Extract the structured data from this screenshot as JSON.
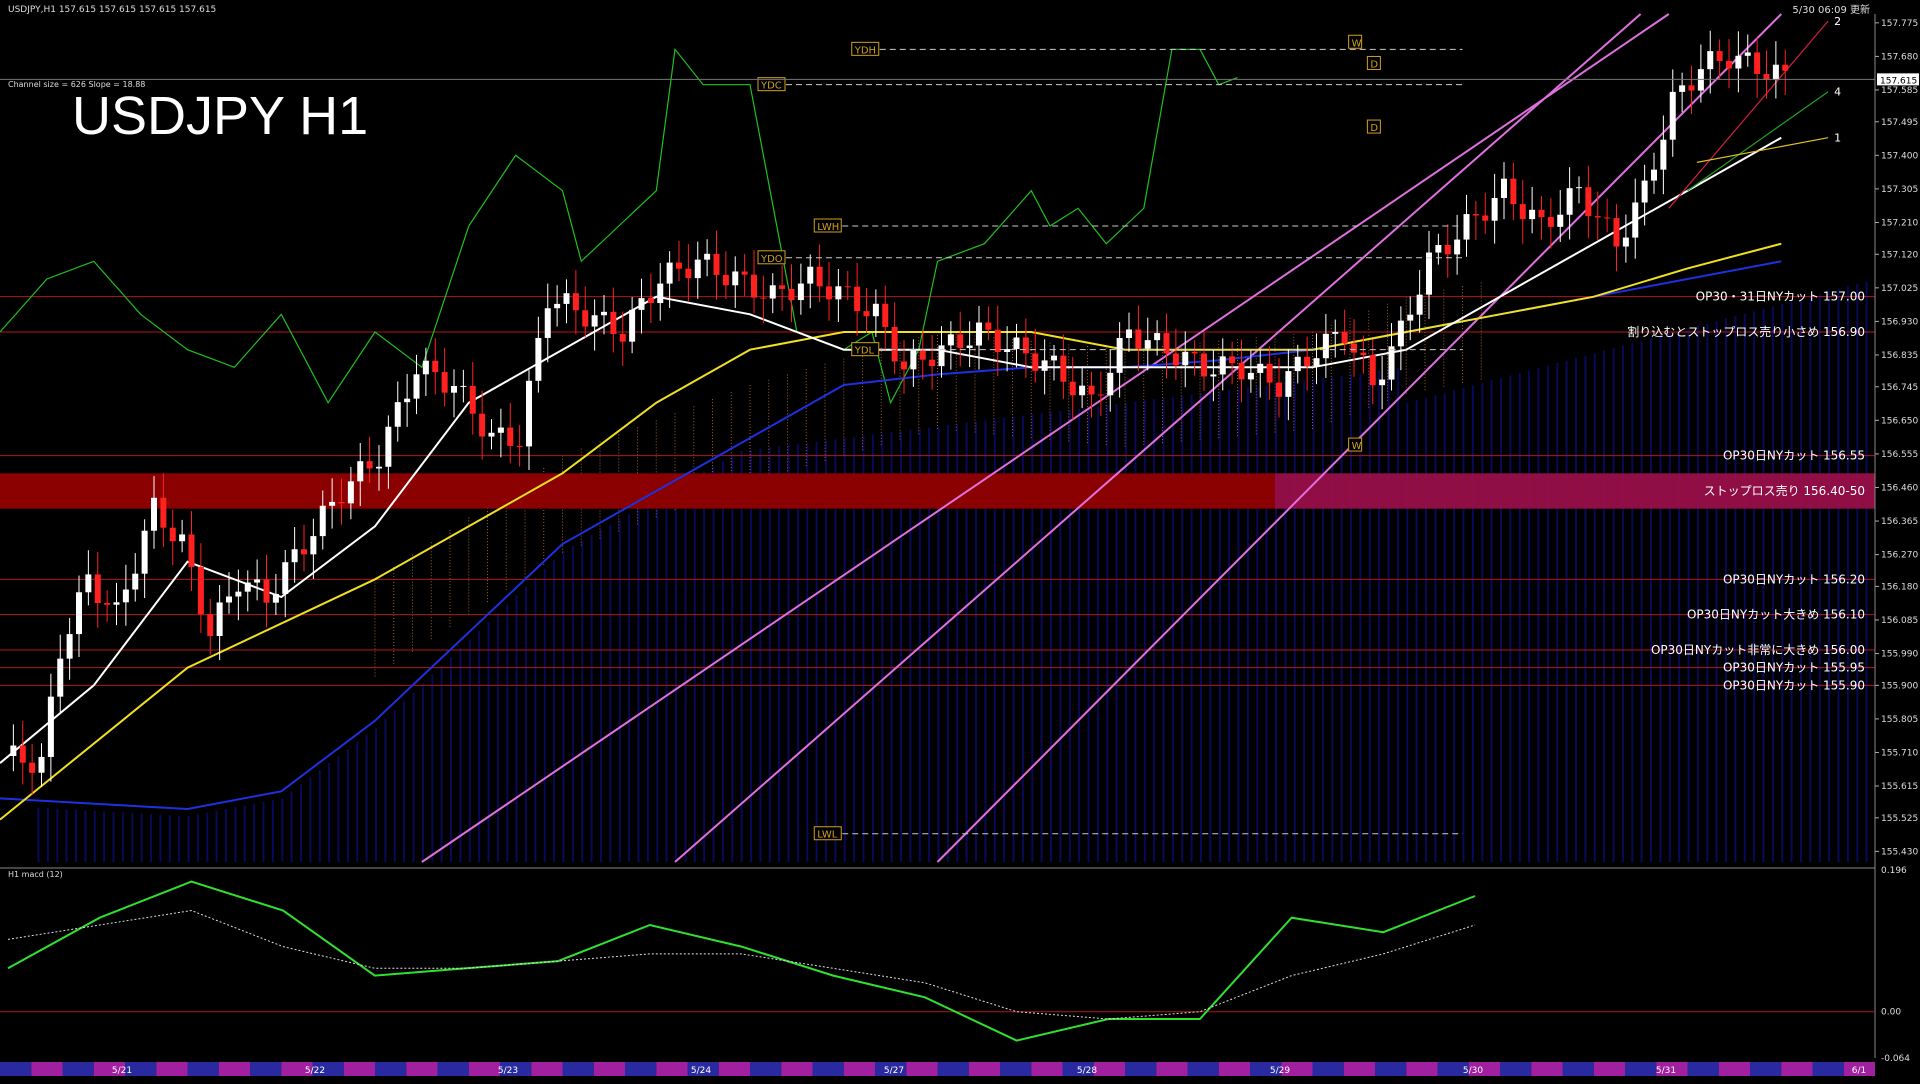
{
  "chart_data": [
    {
      "type": "candlestick",
      "header_text": "USDJPY,H1  157.615 157.615 157.615 157.615",
      "top_right_text": "5/30 06:09 更新",
      "title": "USDJPY H1",
      "channel_text": "Channel size = 626 Slope = 18.88",
      "ylim": [
        155.4,
        157.8
      ],
      "y_ticks": [
        157.775,
        157.68,
        157.585,
        157.495,
        157.4,
        157.305,
        157.21,
        157.12,
        157.025,
        156.93,
        156.835,
        156.745,
        156.65,
        156.555,
        156.46,
        156.365,
        156.27,
        156.18,
        156.085,
        155.99,
        155.9,
        155.805,
        155.71,
        155.615,
        155.525,
        155.43
      ],
      "current_price": 157.615,
      "current_price_text": "157.615",
      "x_ticks": [
        "5/21",
        "5/22",
        "5/23",
        "5/24",
        "5/27",
        "5/28",
        "5/29",
        "5/30",
        "5/31",
        "6/1"
      ],
      "close_path": [
        [
          0,
          155.7
        ],
        [
          4,
          155.68
        ],
        [
          6,
          156.0
        ],
        [
          9,
          156.2
        ],
        [
          12,
          156.1
        ],
        [
          16,
          156.4
        ],
        [
          19,
          156.3
        ],
        [
          22,
          156.05
        ],
        [
          25,
          156.2
        ],
        [
          28,
          156.15
        ],
        [
          32,
          156.3
        ],
        [
          36,
          156.45
        ],
        [
          40,
          156.55
        ],
        [
          44,
          156.8
        ],
        [
          48,
          156.75
        ],
        [
          52,
          156.6
        ],
        [
          55,
          156.6
        ],
        [
          58,
          157.0
        ],
        [
          62,
          156.95
        ],
        [
          66,
          156.9
        ],
        [
          70,
          157.05
        ],
        [
          74,
          157.1
        ],
        [
          78,
          157.05
        ],
        [
          82,
          157.0
        ],
        [
          86,
          157.05
        ],
        [
          90,
          157.0
        ],
        [
          93,
          156.95
        ],
        [
          96,
          156.8
        ],
        [
          100,
          156.85
        ],
        [
          104,
          156.9
        ],
        [
          108,
          156.85
        ],
        [
          112,
          156.8
        ],
        [
          116,
          156.7
        ],
        [
          120,
          156.9
        ],
        [
          124,
          156.85
        ],
        [
          128,
          156.8
        ],
        [
          132,
          156.8
        ],
        [
          136,
          156.75
        ],
        [
          140,
          156.85
        ],
        [
          143,
          156.9
        ],
        [
          146,
          156.75
        ],
        [
          149,
          156.9
        ],
        [
          152,
          157.1
        ],
        [
          156,
          157.2
        ],
        [
          160,
          157.3
        ],
        [
          164,
          157.2
        ],
        [
          168,
          157.3
        ],
        [
          172,
          157.15
        ],
        [
          175,
          157.3
        ],
        [
          178,
          157.55
        ],
        [
          181,
          157.65
        ],
        [
          184,
          157.68
        ],
        [
          187,
          157.65
        ],
        [
          190,
          157.62
        ]
      ],
      "ma_white": [
        [
          0,
          155.68
        ],
        [
          10,
          155.9
        ],
        [
          20,
          156.25
        ],
        [
          30,
          156.15
        ],
        [
          40,
          156.35
        ],
        [
          50,
          156.7
        ],
        [
          60,
          156.85
        ],
        [
          70,
          157.0
        ],
        [
          80,
          156.95
        ],
        [
          90,
          156.85
        ],
        [
          100,
          156.85
        ],
        [
          110,
          156.8
        ],
        [
          120,
          156.8
        ],
        [
          130,
          156.8
        ],
        [
          140,
          156.8
        ],
        [
          150,
          156.85
        ],
        [
          160,
          157.0
        ],
        [
          170,
          157.15
        ],
        [
          180,
          157.3
        ],
        [
          190,
          157.45
        ]
      ],
      "ma_yellow": [
        [
          0,
          155.52
        ],
        [
          20,
          155.95
        ],
        [
          40,
          156.2
        ],
        [
          60,
          156.5
        ],
        [
          70,
          156.7
        ],
        [
          80,
          156.85
        ],
        [
          90,
          156.9
        ],
        [
          100,
          156.9
        ],
        [
          110,
          156.9
        ],
        [
          120,
          156.85
        ],
        [
          130,
          156.85
        ],
        [
          140,
          156.85
        ],
        [
          150,
          156.9
        ],
        [
          160,
          156.95
        ],
        [
          170,
          157.0
        ],
        [
          180,
          157.08
        ],
        [
          190,
          157.15
        ]
      ],
      "ma_blue": [
        [
          0,
          155.58
        ],
        [
          20,
          155.55
        ],
        [
          30,
          155.6
        ],
        [
          40,
          155.8
        ],
        [
          50,
          156.05
        ],
        [
          60,
          156.3
        ],
        [
          70,
          156.45
        ],
        [
          80,
          156.6
        ],
        [
          90,
          156.75
        ],
        [
          100,
          156.78
        ],
        [
          110,
          156.8
        ],
        [
          120,
          156.8
        ],
        [
          130,
          156.82
        ],
        [
          140,
          156.85
        ],
        [
          150,
          156.9
        ],
        [
          160,
          156.95
        ],
        [
          170,
          157.0
        ],
        [
          180,
          157.05
        ],
        [
          190,
          157.1
        ]
      ],
      "chikou_green": [
        [
          0,
          156.9
        ],
        [
          5,
          157.05
        ],
        [
          10,
          157.1
        ],
        [
          15,
          156.95
        ],
        [
          20,
          156.85
        ],
        [
          25,
          156.8
        ],
        [
          30,
          156.95
        ],
        [
          35,
          156.7
        ],
        [
          40,
          156.9
        ],
        [
          45,
          156.8
        ],
        [
          50,
          157.2
        ],
        [
          55,
          157.4
        ],
        [
          60,
          157.3
        ],
        [
          62,
          157.1
        ],
        [
          66,
          157.2
        ],
        [
          70,
          157.3
        ],
        [
          72,
          157.7
        ],
        [
          75,
          157.6
        ],
        [
          80,
          157.6
        ],
        [
          85,
          156.9
        ],
        [
          90,
          156.85
        ],
        [
          93,
          156.9
        ],
        [
          95,
          156.7
        ],
        [
          98,
          156.85
        ],
        [
          100,
          157.1
        ],
        [
          105,
          157.15
        ],
        [
          110,
          157.3
        ],
        [
          112,
          157.2
        ],
        [
          115,
          157.25
        ],
        [
          118,
          157.15
        ],
        [
          120,
          157.2
        ],
        [
          122,
          157.25
        ],
        [
          125,
          157.7
        ],
        [
          128,
          157.7
        ],
        [
          130,
          157.6
        ],
        [
          132,
          157.62
        ]
      ],
      "gann_fan_lines": [
        {
          "label": "2",
          "points": [
            [
              178,
              157.25
            ],
            [
              195,
              157.78
            ]
          ]
        },
        {
          "label": "4",
          "points": [
            [
              180,
              157.3
            ],
            [
              195,
              157.58
            ]
          ]
        },
        {
          "label": "1",
          "points": [
            [
              181,
              157.38
            ],
            [
              195,
              157.45
            ]
          ]
        }
      ],
      "channel_lines": [
        {
          "points": [
            [
              45,
              155.4
            ],
            [
              178,
              157.8
            ]
          ]
        },
        {
          "points": [
            [
              72,
              155.4
            ],
            [
              175,
              157.8
            ]
          ]
        },
        {
          "points": [
            [
              100,
              155.4
            ],
            [
              190,
              157.8
            ]
          ]
        }
      ],
      "horizontal_levels": [
        {
          "price": 157.0,
          "text": "OP30・31日NYカット 157.00"
        },
        {
          "price": 156.9,
          "text": "割り込むとストップロス売り小さめ 156.90"
        },
        {
          "price": 156.55,
          "text": "OP30日NYカット 156.55"
        },
        {
          "price": 156.45,
          "text": "ストップロス売り 156.40-50",
          "zone": [
            156.4,
            156.5
          ]
        },
        {
          "price": 156.2,
          "text": "OP30日NYカット 156.20"
        },
        {
          "price": 156.1,
          "text": "OP30日NYカット大きめ 156.10"
        },
        {
          "price": 156.0,
          "text": "OP30日NYカット非常に大きめ 156.00"
        },
        {
          "price": 155.95,
          "text": "OP30日NYカット 155.95"
        },
        {
          "price": 155.9,
          "text": "OP30日NYカット 155.90"
        }
      ],
      "reference_lines": [
        {
          "label": "YDH",
          "price": 157.7
        },
        {
          "label": "YDC",
          "price": 157.6
        },
        {
          "label": "LWH",
          "price": 157.2
        },
        {
          "label": "YDO",
          "price": 157.11
        },
        {
          "label": "YDL",
          "price": 156.85
        },
        {
          "label": "LWL",
          "price": 155.48
        },
        {
          "label": "W",
          "price": 157.72
        },
        {
          "label": "D",
          "price": 157.66
        },
        {
          "label": "D",
          "price": 157.48
        },
        {
          "label": "W",
          "price": 156.58
        }
      ],
      "legend_position": "none",
      "grid": false
    },
    {
      "type": "line",
      "title": "H1 macd (12)",
      "ylim": [
        -0.064,
        0.196
      ],
      "y_ticks": [
        0.196,
        0.0,
        -0.064
      ],
      "y_tick_labels": [
        "0.196",
        "0.00",
        "-0.064"
      ],
      "x_ticks": [
        "5/21",
        "5/22",
        "5/23",
        "5/24",
        "5/27",
        "5/28",
        "5/29",
        "5/30",
        "5/31",
        "6/1"
      ],
      "series": [
        {
          "values": [
            0.06,
            0.13,
            0.18,
            0.14,
            0.05,
            0.06,
            0.07,
            0.12,
            0.09,
            0.05,
            0.02,
            -0.04,
            -0.01,
            -0.01,
            0.13,
            0.11,
            0.16
          ]
        },
        {
          "values": [
            0.1,
            0.12,
            0.14,
            0.09,
            0.06,
            0.06,
            0.07,
            0.08,
            0.08,
            0.06,
            0.04,
            0.0,
            -0.01,
            0.0,
            0.05,
            0.08,
            0.12
          ]
        }
      ]
    }
  ]
}
